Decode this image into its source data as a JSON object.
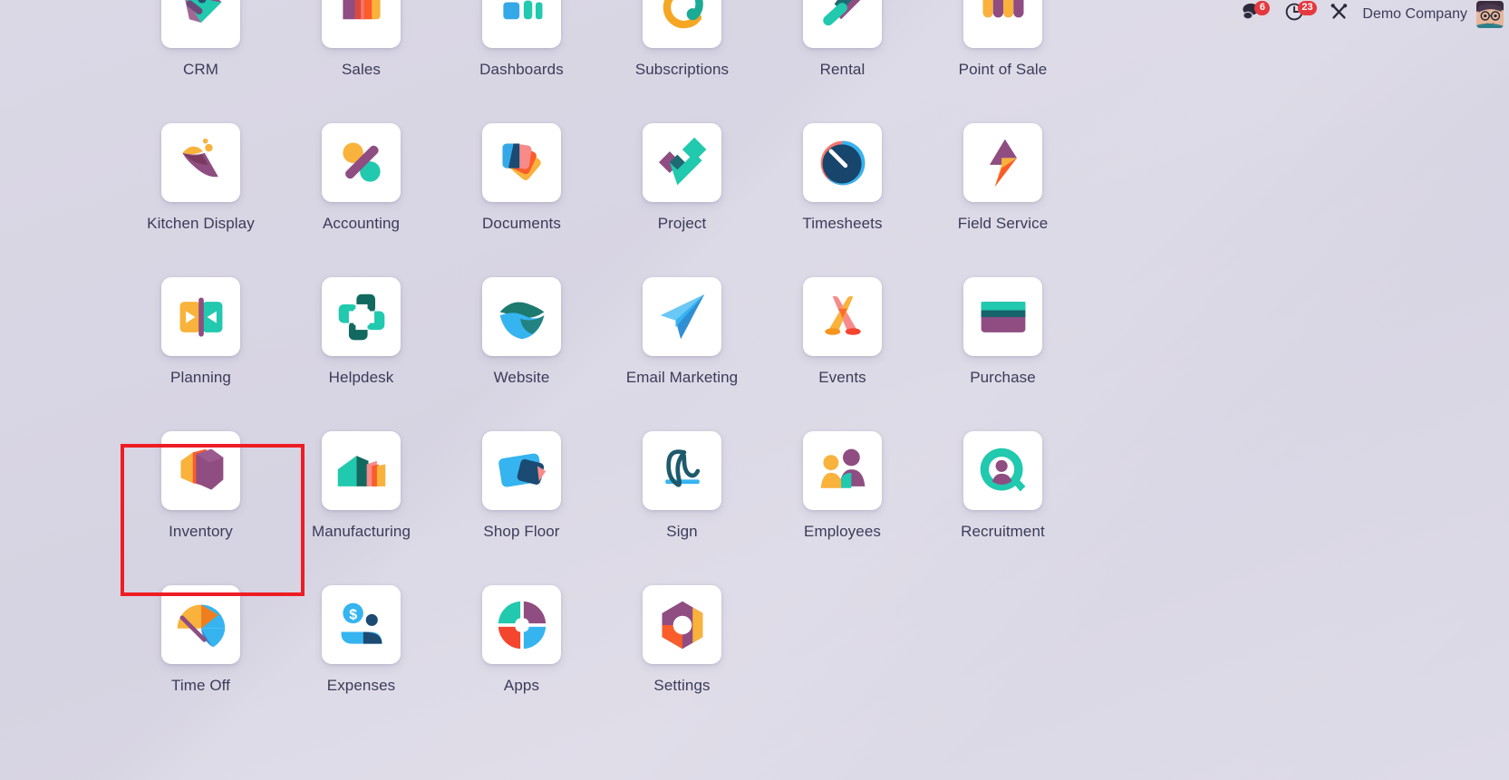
{
  "topbar": {
    "messages": {
      "icon": "chat-bubbles-icon",
      "badge": "6"
    },
    "activities": {
      "icon": "clock-icon",
      "badge": "23"
    },
    "developer_tools": {
      "icon": "wrench-screwdriver-icon"
    },
    "company_name": "Demo Company",
    "avatar": {
      "icon": "user-avatar-icon"
    }
  },
  "highlight": {
    "target": "Inventory",
    "color": "#ee1c25"
  },
  "apps": [
    {
      "label": "CRM",
      "icon": "crm-icon"
    },
    {
      "label": "Sales",
      "icon": "sales-icon"
    },
    {
      "label": "Dashboards",
      "icon": "dashboards-icon"
    },
    {
      "label": "Subscriptions",
      "icon": "subscriptions-icon"
    },
    {
      "label": "Rental",
      "icon": "rental-icon"
    },
    {
      "label": "Point of Sale",
      "icon": "point-of-sale-icon"
    },
    {
      "label": "Kitchen Display",
      "icon": "kitchen-display-icon"
    },
    {
      "label": "Accounting",
      "icon": "accounting-icon"
    },
    {
      "label": "Documents",
      "icon": "documents-icon"
    },
    {
      "label": "Project",
      "icon": "project-icon"
    },
    {
      "label": "Timesheets",
      "icon": "timesheets-icon"
    },
    {
      "label": "Field Service",
      "icon": "field-service-icon"
    },
    {
      "label": "Planning",
      "icon": "planning-icon"
    },
    {
      "label": "Helpdesk",
      "icon": "helpdesk-icon"
    },
    {
      "label": "Website",
      "icon": "website-icon"
    },
    {
      "label": "Email Marketing",
      "icon": "email-marketing-icon"
    },
    {
      "label": "Events",
      "icon": "events-icon"
    },
    {
      "label": "Purchase",
      "icon": "purchase-icon"
    },
    {
      "label": "Inventory",
      "icon": "inventory-icon"
    },
    {
      "label": "Manufacturing",
      "icon": "manufacturing-icon"
    },
    {
      "label": "Shop Floor",
      "icon": "shop-floor-icon"
    },
    {
      "label": "Sign",
      "icon": "sign-icon"
    },
    {
      "label": "Employees",
      "icon": "employees-icon"
    },
    {
      "label": "Recruitment",
      "icon": "recruitment-icon"
    },
    {
      "label": "Time Off",
      "icon": "time-off-icon"
    },
    {
      "label": "Expenses",
      "icon": "expenses-icon"
    },
    {
      "label": "Apps",
      "icon": "apps-icon"
    },
    {
      "label": "Settings",
      "icon": "settings-icon"
    }
  ],
  "colors": {
    "teal": "#21c9ae",
    "purple": "#8f4d82",
    "orange": "#f5a623",
    "red_orange": "#fa5c3a",
    "blue": "#35b4f0",
    "dark_blue": "#17456b",
    "yellow": "#fab632",
    "pink": "#f98a8a",
    "dark_teal": "#12695f",
    "background": "#d8d5e4",
    "label_text": "#3b3b59"
  }
}
